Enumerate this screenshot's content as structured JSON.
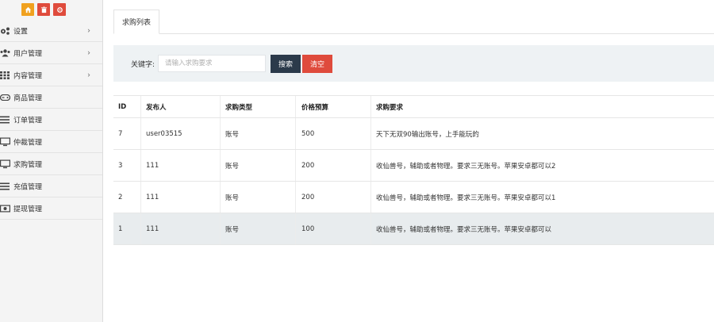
{
  "toolbar": {
    "buttons": [
      {
        "name": "home-icon",
        "glyph": "⌂",
        "color": "#f0a11f"
      },
      {
        "name": "trash-icon",
        "glyph": "🗑",
        "color": "#df4b3c"
      },
      {
        "name": "refresh-icon",
        "glyph": "⟲",
        "color": "#df4b3c"
      }
    ]
  },
  "sidebar": {
    "items": [
      {
        "label": "设置",
        "icon": "gears-icon",
        "arrow": "›"
      },
      {
        "label": "用户管理",
        "icon": "users-icon",
        "arrow": "›"
      },
      {
        "label": "内容管理",
        "icon": "grid-icon",
        "arrow": "›"
      },
      {
        "label": "商品管理",
        "icon": "gamepad-icon",
        "arrow": ""
      },
      {
        "label": "订单管理",
        "icon": "list-icon",
        "arrow": ""
      },
      {
        "label": "仲裁管理",
        "icon": "monitor-icon",
        "arrow": ""
      },
      {
        "label": "求购管理",
        "icon": "monitor-icon",
        "arrow": ""
      },
      {
        "label": "充值管理",
        "icon": "list-icon",
        "arrow": ""
      },
      {
        "label": "提现管理",
        "icon": "money-icon",
        "arrow": ""
      }
    ]
  },
  "tabs": [
    {
      "label": "求购列表"
    }
  ],
  "search": {
    "label": "关键字:",
    "placeholder": "请输入求购要求",
    "search_button": "搜索",
    "clear_button": "清空"
  },
  "table": {
    "headers": [
      "ID",
      "发布人",
      "求购类型",
      "价格预算",
      "求购要求"
    ],
    "rows": [
      [
        "7",
        "user03515",
        "账号",
        "500",
        "天下无双90输出账号，上手能玩的"
      ],
      [
        "3",
        "111",
        "账号",
        "200",
        "收仙兽号，辅助或者物理。要求三无账号。苹果安卓都可以2"
      ],
      [
        "2",
        "111",
        "账号",
        "200",
        "收仙兽号，辅助或者物理。要求三无账号。苹果安卓都可以1"
      ],
      [
        "1",
        "111",
        "账号",
        "100",
        "收仙兽号，辅助或者物理。要求三无账号。苹果安卓都可以"
      ]
    ]
  },
  "colors": {
    "accent_dark": "#2b3a4a",
    "danger": "#df4b3c",
    "warning": "#f0a11f"
  }
}
